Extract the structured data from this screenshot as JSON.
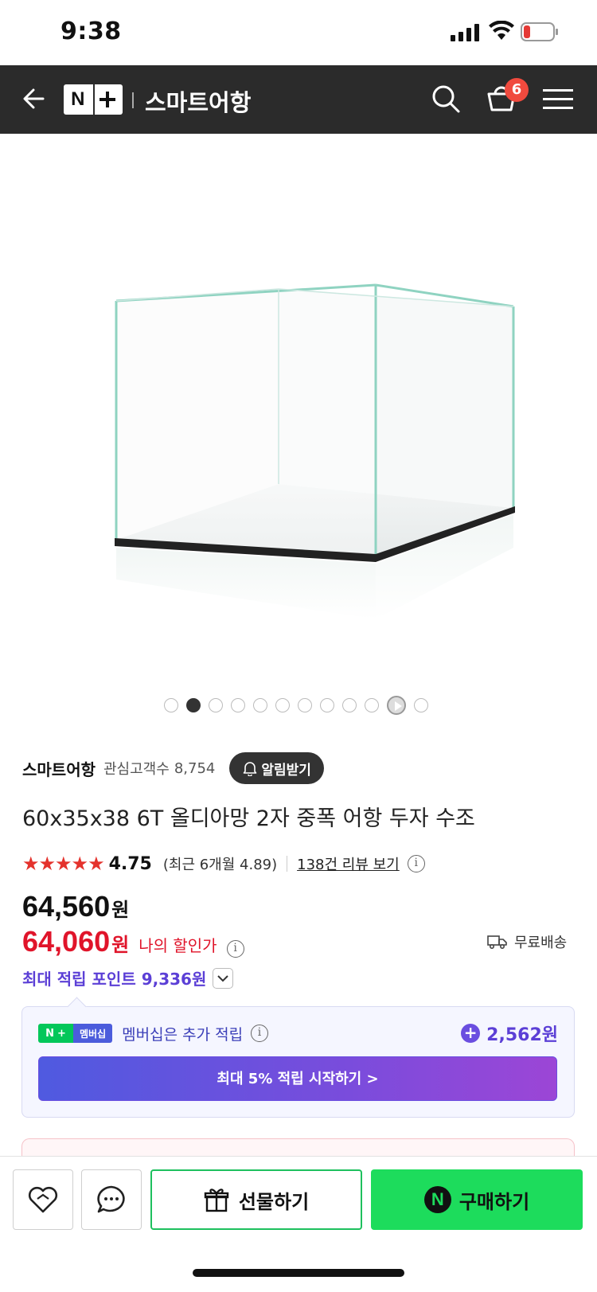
{
  "status_bar": {
    "time": "9:38"
  },
  "header": {
    "logo_text": "N+",
    "store_name": "스마트어항",
    "cart_count": "6"
  },
  "gallery": {
    "total": 11,
    "active_index": 1,
    "video_index": 10
  },
  "store": {
    "name": "스마트어항",
    "fans_label": "관심고객수",
    "fans_count": "8,754",
    "alarm_label": "알림받기"
  },
  "product": {
    "title": "60x35x38 6T 올디아망 2자 중폭 어항 두자 수조",
    "stars": "★★★★★",
    "rating": "4.75",
    "recent_rating": "(최근 6개월 4.89)",
    "review_link": "138건 리뷰 보기"
  },
  "price": {
    "original": "64,560",
    "original_unit": "원",
    "discounted": "64,060",
    "discounted_unit": "원",
    "my_discount_label": "나의 할인가",
    "shipping": "무료배송",
    "max_points": "최대 적립 포인트 9,336원"
  },
  "membership": {
    "badge_right": "멤버십",
    "text": "멤버십은 추가 적립",
    "points": "2,562원",
    "cta": "최대 5% 적립 시작하기 >"
  },
  "bottom": {
    "gift_label": "선물하기",
    "buy_label": "구매하기",
    "buy_logo": "N"
  },
  "colors": {
    "header_bg": "#2b2b2b",
    "discount_red": "#e0142a",
    "points_purple": "#5b3fd6",
    "buy_green": "#1ddc5c",
    "badge_red": "#f04a3e"
  }
}
